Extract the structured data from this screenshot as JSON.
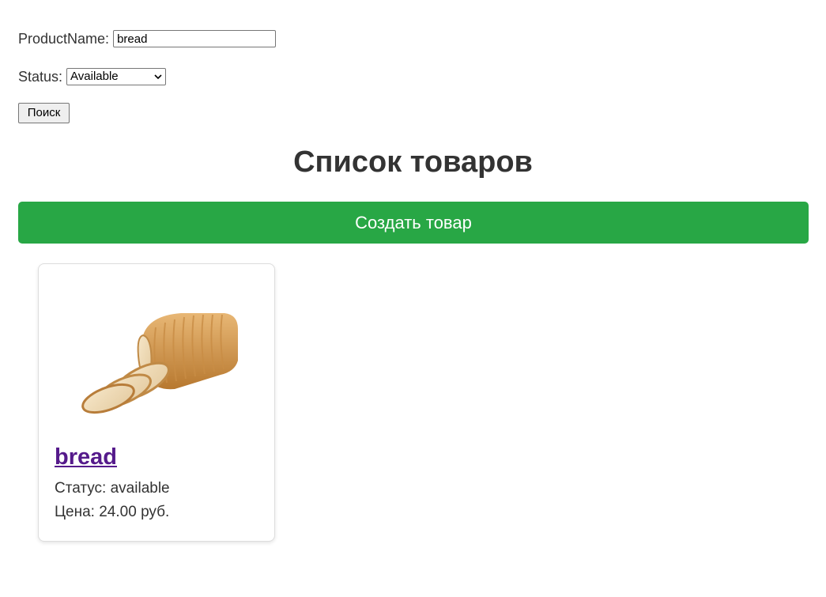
{
  "filter": {
    "name_label": "ProductName:",
    "name_value": "bread",
    "status_label": "Status:",
    "status_selected": "Available",
    "search_label": "Поиск"
  },
  "page_title": "Список товаров",
  "create_button_label": "Создать товар",
  "colors": {
    "create_button": "#28a745",
    "product_link": "#551a8b"
  },
  "products": [
    {
      "name": "bread",
      "status_text": "Статус: available",
      "price_text": "Цена: 24.00 руб.",
      "image_icon": "sliced-bread-loaf"
    }
  ]
}
